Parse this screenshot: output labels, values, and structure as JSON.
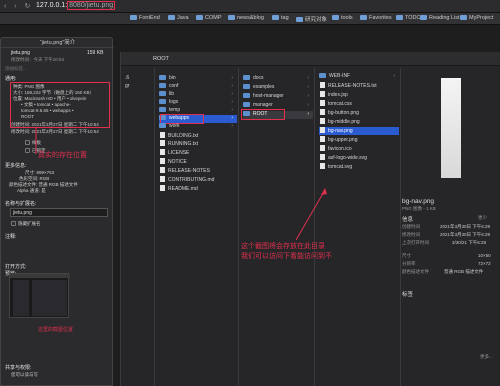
{
  "browser": {
    "url_host": "127.0.0.1:",
    "url_port_dim": "8080/",
    "url_path": "jietu.png",
    "nav_icons": "‹ › ↻"
  },
  "bookmarks": [
    {
      "label": "FontEnd"
    },
    {
      "label": "Java"
    },
    {
      "label": "COMP"
    },
    {
      "label": "news&blog"
    },
    {
      "label": "tag"
    },
    {
      "label": "研究对象"
    },
    {
      "label": "tools"
    },
    {
      "label": "Favorites"
    },
    {
      "label": "TODO"
    },
    {
      "label": "Reading List"
    },
    {
      "label": "MyProject"
    }
  ],
  "finder": {
    "path_label": "ROOT",
    "col1_items": [
      ".6",
      "gr"
    ],
    "col2_items": [
      "bin",
      "conf",
      "lib",
      "logs",
      "temp",
      "webapps",
      "work",
      "BUILDING.txt",
      "CONTRIBUTING.md",
      "LICENSE",
      "NOTICE",
      "README.md",
      "RELEASE-NOTES",
      "RUNNING.txt"
    ],
    "col2_sorted": [
      "bin",
      "conf",
      "lib",
      "logs",
      "temp",
      "webapps",
      "work",
      "BUILDING.txt",
      "RUNNING.txt",
      "LICENSE",
      "NOTICE",
      "RELEASE-NOTES",
      "CONTRIBUTING.md",
      "README.md"
    ],
    "col3_items": [
      "docs",
      "examples",
      "host-manager",
      "manager",
      "ROOT"
    ],
    "col4_items": [
      "WEB-INF",
      "RELEASE-NOTES.txt",
      "index.jsp",
      "tomcat.css",
      "bg-button.png",
      "bg-middle.png",
      "bg-nav.png",
      "bg-upper.png",
      "favicon.ico",
      "asf-logo-wide.svg",
      "tomcat.svg"
    ]
  },
  "preview": {
    "filename": "bg-nav.png",
    "kind": "PNG 图像 - 1 KB",
    "info_label": "信息",
    "more_label": "更少",
    "created_label": "创建时间",
    "created_value": "2021年3月30日 下午6:28",
    "modified_label": "修改时间",
    "modified_value": "2021年3月30日 下午6:28",
    "opened_label": "上次打开时间",
    "opened_value": "3/30/21 下午6:28",
    "size_label": "尺寸",
    "size_value": "10×50",
    "res_label": "分辨率",
    "res_value": "72×72",
    "color_label": "颜色描述文件",
    "color_value": "普通 RGB 描述文件",
    "tags_label": "标签",
    "more_btn": "更多..."
  },
  "info_panel": {
    "title": "“jietu.png”简介",
    "filename": "jietu.png",
    "filesize": "159 KB",
    "modified_short": "修改时间：今天 下午10:54",
    "tags_hint": "添加标签…",
    "general_label": "通用:",
    "kind_line": "种类: PNG 图像",
    "size_line": "大小: 159,222 字节（磁盘上的 160 KB）",
    "where_line": "位置: Macintosh HD • 用户 • xlvepein",
    "where_line2": "• 文稿 • tomcat • apache-",
    "where_line3": "tomcat-8.5.65 • webapps •",
    "where_line4": "ROOT",
    "created_line": "创建时间: 2021年3月27日 星期二 下午10:54",
    "modified_line": "修改时间: 2021年3月27日 星期二 下午10:54",
    "stationery": "样板",
    "locked": "已锁定",
    "more_info": "更多信息:",
    "dims_label": "尺寸: 899×763",
    "color_space": "色彩空间: RGB",
    "profile": "颜色描述文件: 普通 RGB 描述文件",
    "alpha": "Alpha 通道: 是",
    "name_ext": "名称与扩展名:",
    "name_value": "jietu.png",
    "hide_ext": "隐藏扩展名",
    "comments": "注释:",
    "open_with": "打开方式:",
    "preview": "预览:",
    "sharing": "共享与权限:",
    "permission": "您可以读与写"
  },
  "annotations": {
    "real_location": "真实的存在位置",
    "screenshot_note_1": "这个截图将会存放在此目录",
    "screenshot_note_2": "我们可以访问下看能访问到不",
    "thumb_note": "这里的截图位置"
  },
  "colors": {
    "annotation_red": "#e0304e",
    "selection_blue": "#2a5bd0",
    "folder_blue": "#5b8fce"
  }
}
